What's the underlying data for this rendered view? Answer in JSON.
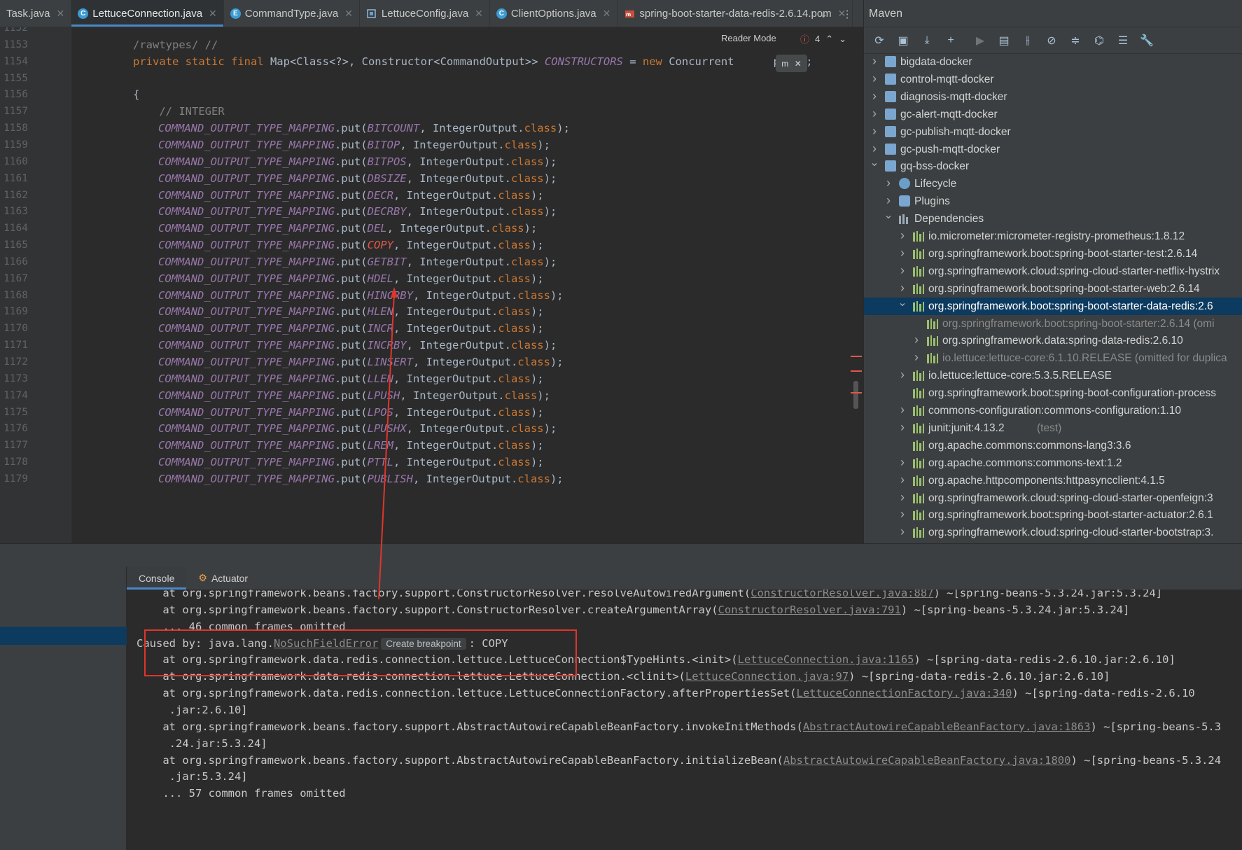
{
  "tabs": [
    {
      "label": "Task.java",
      "icon": "",
      "active": false
    },
    {
      "label": "LettuceConnection.java",
      "icon": "C",
      "active": true
    },
    {
      "label": "CommandType.java",
      "icon": "E",
      "active": false
    },
    {
      "label": "LettuceConfig.java",
      "icon": "config",
      "active": false
    },
    {
      "label": "ClientOptions.java",
      "icon": "C",
      "active": false
    },
    {
      "label": "spring-boot-starter-data-redis-2.6.14.pom",
      "icon": "pom",
      "active": false
    }
  ],
  "editor": {
    "reader_mode": "Reader Mode",
    "error_count": "4",
    "maven_float_icon": "m",
    "lines": [
      {
        "n": "1152",
        "segments": []
      },
      {
        "n": "1153",
        "segments": [
          {
            "t": "/rawtypes/ //",
            "c": "cm"
          }
        ]
      },
      {
        "n": "1154",
        "segments": [
          {
            "t": "private static final ",
            "c": "kw"
          },
          {
            "t": "Map<Class<?>, Constructor<CommandOutput>> ",
            "c": ""
          },
          {
            "t": "CONSTRUCTORS",
            "c": "ital"
          },
          {
            "t": " = ",
            "c": ""
          },
          {
            "t": "new ",
            "c": "kw"
          },
          {
            "t": "Concurrent",
            "c": ""
          },
          {
            "t": "      ",
            "c": ""
          },
          {
            "t": "p<>();",
            "c": ""
          }
        ]
      },
      {
        "n": "1155",
        "segments": []
      },
      {
        "n": "1156",
        "segments": [
          {
            "t": "{",
            "c": ""
          }
        ]
      },
      {
        "n": "1157",
        "segments": [
          {
            "t": "    // INTEGER",
            "c": "cm"
          }
        ]
      },
      {
        "n": "1158",
        "cmd": "BITCOUNT"
      },
      {
        "n": "1159",
        "cmd": "BITOP"
      },
      {
        "n": "1160",
        "cmd": "BITPOS"
      },
      {
        "n": "1161",
        "cmd": "DBSIZE"
      },
      {
        "n": "1162",
        "cmd": "DECR"
      },
      {
        "n": "1163",
        "cmd": "DECRBY"
      },
      {
        "n": "1164",
        "cmd": "DEL"
      },
      {
        "n": "1165",
        "cmd": "COPY",
        "highlight": true
      },
      {
        "n": "1166",
        "cmd": "GETBIT"
      },
      {
        "n": "1167",
        "cmd": "HDEL"
      },
      {
        "n": "1168",
        "cmd": "HINCRBY"
      },
      {
        "n": "1169",
        "cmd": "HLEN"
      },
      {
        "n": "1170",
        "cmd": "INCR"
      },
      {
        "n": "1171",
        "cmd": "INCRBY"
      },
      {
        "n": "1172",
        "cmd": "LINSERT"
      },
      {
        "n": "1173",
        "cmd": "LLEN"
      },
      {
        "n": "1174",
        "cmd": "LPUSH"
      },
      {
        "n": "1175",
        "cmd": "LPOS"
      },
      {
        "n": "1176",
        "cmd": "LPUSHX"
      },
      {
        "n": "1177",
        "cmd": "LREM"
      },
      {
        "n": "1178",
        "cmd": "PTTL"
      },
      {
        "n": "1179",
        "cmd": "PUBLISH"
      }
    ],
    "mapping_name": "COMMAND_OUTPUT_TYPE_MAPPING",
    "put_text": ".put(",
    "output_class": ", IntegerOutput.",
    "class_kw": "class",
    "tail": ");"
  },
  "maven": {
    "title": "Maven",
    "toolbar_icons": [
      "reload-icon",
      "add-folder-icon",
      "download-icon",
      "plus-icon",
      "run-icon",
      "execute-goal-icon",
      "toggle-offline-icon",
      "skip-tests-icon",
      "collapse-icon",
      "show-deps-icon",
      "lifecycle-icon",
      "settings-icon"
    ],
    "tree": [
      {
        "label": "bigdata-docker",
        "level": 0,
        "kind": "module",
        "arrow": "right"
      },
      {
        "label": "control-mqtt-docker",
        "level": 0,
        "kind": "module",
        "arrow": "right"
      },
      {
        "label": "diagnosis-mqtt-docker",
        "level": 0,
        "kind": "module",
        "arrow": "right"
      },
      {
        "label": "gc-alert-mqtt-docker",
        "level": 0,
        "kind": "module",
        "arrow": "right"
      },
      {
        "label": "gc-publish-mqtt-docker",
        "level": 0,
        "kind": "module",
        "arrow": "right"
      },
      {
        "label": "gc-push-mqtt-docker",
        "level": 0,
        "kind": "module",
        "arrow": "right"
      },
      {
        "label": "gq-bss-docker",
        "level": 0,
        "kind": "module",
        "arrow": "down"
      },
      {
        "label": "Lifecycle",
        "level": 1,
        "kind": "lifecycle",
        "arrow": "right"
      },
      {
        "label": "Plugins",
        "level": 1,
        "kind": "plugins",
        "arrow": "right"
      },
      {
        "label": "Dependencies",
        "level": 1,
        "kind": "deps",
        "arrow": "down"
      },
      {
        "label": "io.micrometer:micrometer-registry-prometheus:1.8.12",
        "level": 2,
        "kind": "dep",
        "arrow": "right"
      },
      {
        "label": "org.springframework.boot:spring-boot-starter-test:2.6.14",
        "level": 2,
        "kind": "dep",
        "arrow": "right"
      },
      {
        "label": "org.springframework.cloud:spring-cloud-starter-netflix-hystrix",
        "level": 2,
        "kind": "dep",
        "arrow": "right"
      },
      {
        "label": "org.springframework.boot:spring-boot-starter-web:2.6.14",
        "level": 2,
        "kind": "dep",
        "arrow": "right"
      },
      {
        "label": "org.springframework.boot:spring-boot-starter-data-redis:2.6",
        "level": 2,
        "kind": "dep",
        "arrow": "down",
        "selected": true
      },
      {
        "label": "org.springframework.boot:spring-boot-starter:2.6.14 (omi",
        "level": 3,
        "kind": "dep",
        "arrow": "",
        "grey": true
      },
      {
        "label": "org.springframework.data:spring-data-redis:2.6.10",
        "level": 3,
        "kind": "dep",
        "arrow": "right"
      },
      {
        "label": "io.lettuce:lettuce-core:6.1.10.RELEASE (omitted for duplica",
        "level": 3,
        "kind": "dep",
        "arrow": "right",
        "grey": true
      },
      {
        "label": "io.lettuce:lettuce-core:5.3.5.RELEASE",
        "level": 2,
        "kind": "dep",
        "arrow": "right"
      },
      {
        "label": "org.springframework.boot:spring-boot-configuration-process",
        "level": 2,
        "kind": "dep",
        "arrow": ""
      },
      {
        "label": "commons-configuration:commons-configuration:1.10",
        "level": 2,
        "kind": "dep",
        "arrow": "right"
      },
      {
        "label": "junit:junit:4.13.2",
        "suffix": " (test)",
        "level": 2,
        "kind": "dep",
        "arrow": "right"
      },
      {
        "label": "org.apache.commons:commons-lang3:3.6",
        "level": 2,
        "kind": "dep",
        "arrow": ""
      },
      {
        "label": "org.apache.commons:commons-text:1.2",
        "level": 2,
        "kind": "dep",
        "arrow": "right"
      },
      {
        "label": "org.apache.httpcomponents:httpasyncclient:4.1.5",
        "level": 2,
        "kind": "dep",
        "arrow": "right"
      },
      {
        "label": "org.springframework.cloud:spring-cloud-starter-openfeign:3",
        "level": 2,
        "kind": "dep",
        "arrow": "right"
      },
      {
        "label": "org.springframework.boot:spring-boot-starter-actuator:2.6.1",
        "level": 2,
        "kind": "dep",
        "arrow": "right"
      },
      {
        "label": "org.springframework.cloud:spring-cloud-starter-bootstrap:3.",
        "level": 2,
        "kind": "dep",
        "arrow": "right"
      }
    ]
  },
  "console": {
    "tabs": [
      {
        "label": "Console",
        "active": true
      },
      {
        "label": "Actuator",
        "active": false
      }
    ],
    "create_breakpoint": "Create breakpoint",
    "lines": [
      {
        "parts": [
          {
            "t": "    at org.springframework.beans.factory.support.ConstructorResolver.resolveAutowiredArgument("
          },
          {
            "t": "ConstructorResolver.java:887",
            "link": true
          },
          {
            "t": ") ~[spring-beans-5.3.24.jar:5.3.24]"
          }
        ]
      },
      {
        "parts": [
          {
            "t": "    at org.springframework.beans.factory.support.ConstructorResolver.createArgumentArray("
          },
          {
            "t": "ConstructorResolver.java:791",
            "link": true
          },
          {
            "t": ") ~[spring-beans-5.3.24.jar:5.3.24]"
          }
        ]
      },
      {
        "parts": [
          {
            "t": "    ... 46 common frames omitted"
          }
        ]
      },
      {
        "parts": [
          {
            "t": "Caused by: java.lang."
          },
          {
            "t": "NoSuchFieldError",
            "link": true
          },
          {
            "t": "",
            "bp": true
          },
          {
            "t": ": COPY"
          }
        ]
      },
      {
        "parts": [
          {
            "t": "    at org.springframework.data.redis.connection.lettuce.LettuceConnection$TypeHints.<init>("
          },
          {
            "t": "LettuceConnection.java:1165",
            "link": true
          },
          {
            "t": ") ~[spring-data-redis-2.6.10.jar:2.6.10]"
          }
        ]
      },
      {
        "parts": [
          {
            "t": "    at org.springframework.data.redis.connection.lettuce.LettuceConnection.<clinit>("
          },
          {
            "t": "LettuceConnection.java:97",
            "link": true
          },
          {
            "t": ") ~[spring-data-redis-2.6.10.jar:2.6.10]"
          }
        ]
      },
      {
        "parts": [
          {
            "t": "    at org.springframework.data.redis.connection.lettuce.LettuceConnectionFactory.afterPropertiesSet("
          },
          {
            "t": "LettuceConnectionFactory.java:340",
            "link": true
          },
          {
            "t": ") ~[spring-data-redis-2.6.10"
          }
        ]
      },
      {
        "parts": [
          {
            "t": "     .jar:2.6.10]"
          }
        ]
      },
      {
        "parts": [
          {
            "t": "    at org.springframework.beans.factory.support.AbstractAutowireCapableBeanFactory.invokeInitMethods("
          },
          {
            "t": "AbstractAutowireCapableBeanFactory.java:1863",
            "link": true
          },
          {
            "t": ") ~[spring-beans-5.3"
          }
        ]
      },
      {
        "parts": [
          {
            "t": "     .24.jar:5.3.24]"
          }
        ]
      },
      {
        "parts": [
          {
            "t": "    at org.springframework.beans.factory.support.AbstractAutowireCapableBeanFactory.initializeBean("
          },
          {
            "t": "AbstractAutowireCapableBeanFactory.java:1800",
            "link": true
          },
          {
            "t": ") ~[spring-beans-5.3.24"
          }
        ]
      },
      {
        "parts": [
          {
            "t": "     .jar:5.3.24]"
          }
        ]
      },
      {
        "parts": [
          {
            "t": "    ... 57 common frames omitted"
          }
        ]
      }
    ]
  }
}
